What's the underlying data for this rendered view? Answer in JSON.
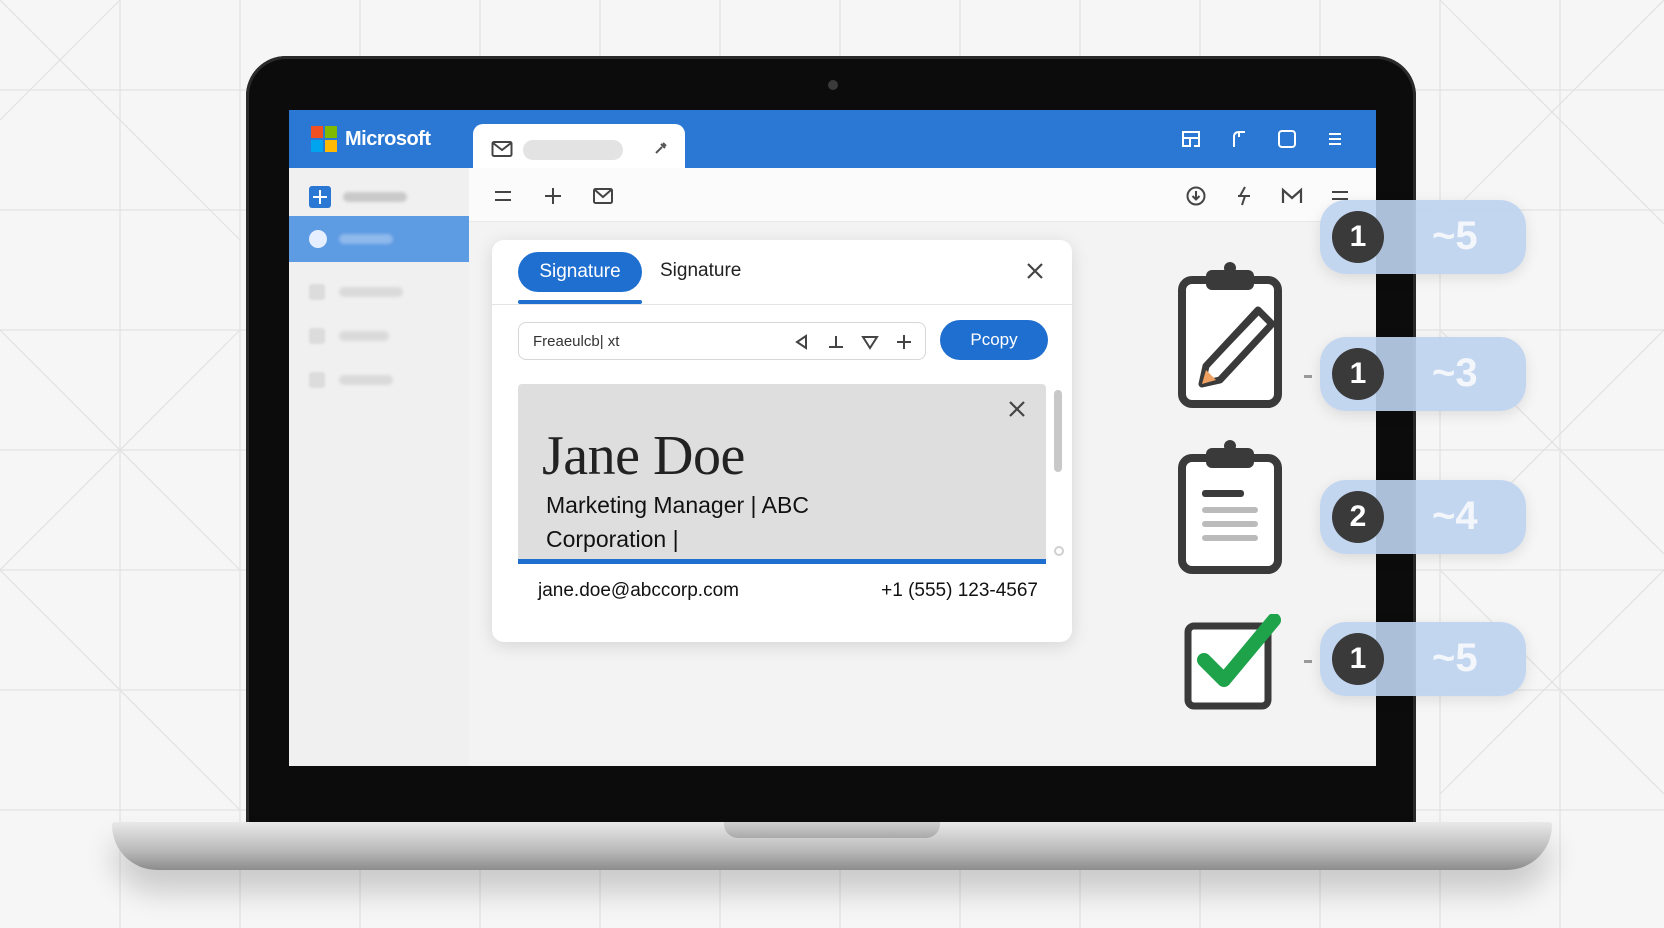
{
  "app": {
    "brand": "Microsoft",
    "accent_color": "#2b78d4",
    "button_color": "#1f6fd1"
  },
  "window_tab": {
    "icon": "mail-icon",
    "pin_icon": "pin-icon"
  },
  "top_icons": [
    "layout-icon",
    "pen-icon",
    "window-icon",
    "menu-icon"
  ],
  "toolbar": {
    "left_icons": [
      "menu-icon",
      "plus-icon",
      "mail-icon"
    ],
    "right_icons": [
      "download-icon",
      "lightning-icon",
      "gmail-icon",
      "menu-icon"
    ]
  },
  "dialog": {
    "tab_active": "Signature",
    "tab_second": "Signature",
    "field_value": "Freaeulcb| xt",
    "copy_button": "Pcopy",
    "signature": {
      "name": "Jane Doe",
      "title": "Marketing Manager | ABC Corporation |"
    },
    "email": "jane.doe@abccorp.com",
    "phone": "+1 (555) 123-4567"
  },
  "steps": [
    {
      "icon": "clipboard-pencil-icon",
      "number": "1",
      "estimate": "~5"
    },
    {
      "icon": "clipboard-pencil-icon",
      "number": "1",
      "estimate": "~3"
    },
    {
      "icon": "clipboard-list-icon",
      "number": "2",
      "estimate": "~4"
    },
    {
      "icon": "checkbox-checked-icon",
      "number": "1",
      "estimate": "~5"
    }
  ],
  "colors": {
    "check_green": "#1fa34a",
    "icon_dark": "#3a3a3a",
    "badge_bg": "#bed3f0"
  }
}
